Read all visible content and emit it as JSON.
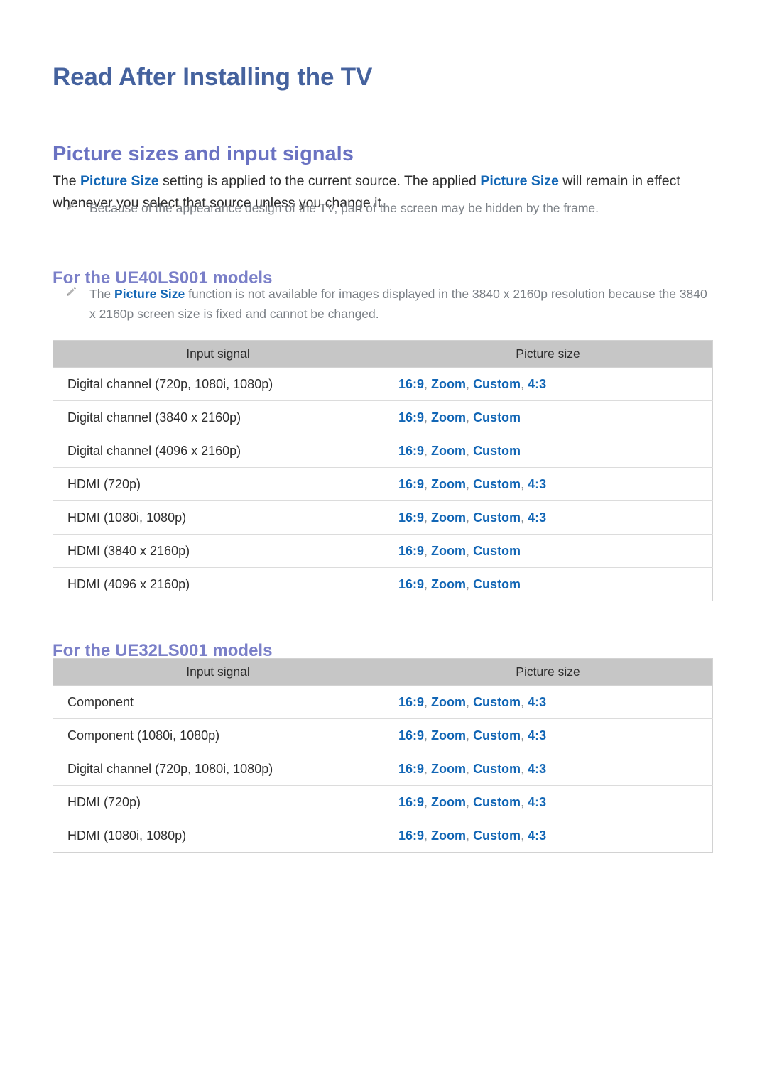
{
  "document": {
    "title": "Read After Installing the TV",
    "section_title": "Picture sizes and input signals",
    "intro": {
      "part1": "The ",
      "keyword1": "Picture Size",
      "part2": " setting is applied to the current source. The applied ",
      "keyword2": "Picture Size",
      "part3": " will remain in effect whenever you select that source unless you change it."
    },
    "notes": {
      "frame": "Because of the appearance design of the TV, part of the screen may be hidden by the frame.",
      "uhd": {
        "part1": "The ",
        "keyword": "Picture Size",
        "part2": " function is not available for images displayed in the 3840 x 2160p resolution because the 3840 x 2160p screen size is fixed and cannot be changed."
      }
    },
    "icons": {
      "note": "pencil-icon"
    },
    "colors": {
      "doc_title": "#45629e",
      "section_title": "#6a72c2",
      "sub_title": "#7a7fc8",
      "keyword_blue": "#1266b5",
      "table_header_bg": "#c6c6c6",
      "body_text": "#2d2d2d",
      "note_text": "#7a7f85"
    },
    "sections": [
      {
        "heading": "For the UE40LS001 models",
        "table": {
          "columns": [
            "Input signal",
            "Picture size"
          ],
          "rows": [
            {
              "signal": "Digital channel (720p, 1080i, 1080p)",
              "sizes": [
                "16:9",
                "Zoom",
                "Custom",
                "4:3"
              ]
            },
            {
              "signal": "Digital channel (3840 x 2160p)",
              "sizes": [
                "16:9",
                "Zoom",
                "Custom"
              ]
            },
            {
              "signal": "Digital channel (4096 x 2160p)",
              "sizes": [
                "16:9",
                "Zoom",
                "Custom"
              ]
            },
            {
              "signal": "HDMI (720p)",
              "sizes": [
                "16:9",
                "Zoom",
                "Custom",
                "4:3"
              ]
            },
            {
              "signal": "HDMI (1080i, 1080p)",
              "sizes": [
                "16:9",
                "Zoom",
                "Custom",
                "4:3"
              ]
            },
            {
              "signal": "HDMI (3840 x 2160p)",
              "sizes": [
                "16:9",
                "Zoom",
                "Custom"
              ]
            },
            {
              "signal": "HDMI (4096 x 2160p)",
              "sizes": [
                "16:9",
                "Zoom",
                "Custom"
              ]
            }
          ]
        }
      },
      {
        "heading": "For the UE32LS001 models",
        "table": {
          "columns": [
            "Input signal",
            "Picture size"
          ],
          "rows": [
            {
              "signal": "Component",
              "sizes": [
                "16:9",
                "Zoom",
                "Custom",
                "4:3"
              ]
            },
            {
              "signal": "Component (1080i, 1080p)",
              "sizes": [
                "16:9",
                "Zoom",
                "Custom",
                "4:3"
              ]
            },
            {
              "signal": "Digital channel (720p, 1080i, 1080p)",
              "sizes": [
                "16:9",
                "Zoom",
                "Custom",
                "4:3"
              ]
            },
            {
              "signal": "HDMI (720p)",
              "sizes": [
                "16:9",
                "Zoom",
                "Custom",
                "4:3"
              ]
            },
            {
              "signal": "HDMI (1080i, 1080p)",
              "sizes": [
                "16:9",
                "Zoom",
                "Custom",
                "4:3"
              ]
            }
          ]
        }
      }
    ]
  }
}
